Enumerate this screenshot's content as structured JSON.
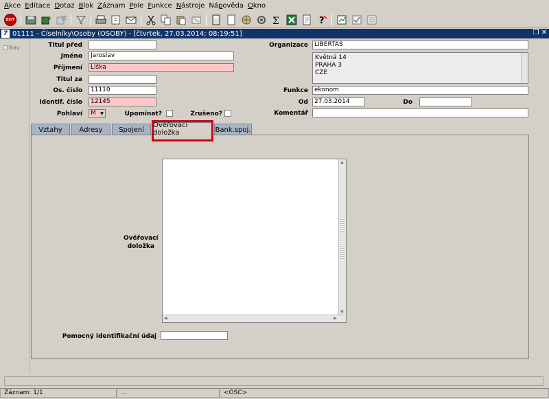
{
  "menu": [
    "Akce",
    "Editace",
    "Dotaz",
    "Blok",
    "Záznam",
    "Pole",
    "Funkce",
    "Nástroje",
    "Nápověda",
    "Okno"
  ],
  "menu_underline": [
    "A",
    "E",
    "D",
    "B",
    "Z",
    "P",
    "F",
    "N",
    "p",
    "O"
  ],
  "toolbar": {
    "exit_label": "EXIT",
    "icons": [
      "save-icon",
      "add-record-icon",
      "delete-record-icon",
      "filter-icon",
      "print-icon",
      "attach-icon",
      "mail-icon",
      "cut-icon",
      "copy-icon",
      "paste-icon",
      "clear-icon",
      "calculator-icon",
      "page-icon",
      "globe-icon",
      "tools-icon",
      "sum-icon",
      "excel-icon",
      "doc-icon",
      "help-icon",
      "report-icon",
      "check-icon",
      "list-icon"
    ]
  },
  "window": {
    "title": "01111 - Číselníky\\Osoby (OSOBY) - [čtvrtek, 27.03.2014; 08:19:51]",
    "logo": "7"
  },
  "nav": {
    "label": "Nav"
  },
  "form": {
    "titul_pred": {
      "label": "Titul před",
      "value": ""
    },
    "jmeno": {
      "label": "Jméno",
      "value": "Jaroslav"
    },
    "prijmeni": {
      "label": "Příjmení",
      "value": "Liška"
    },
    "titul_za": {
      "label": "Titul za",
      "value": ""
    },
    "os_cislo": {
      "label": "Os. číslo",
      "value": "11110"
    },
    "identif_cislo": {
      "label": "Identif. číslo",
      "value": "12145"
    },
    "pohlavi": {
      "label": "Pohlaví",
      "value": "M"
    },
    "upominat": {
      "label": "Upomínat?"
    },
    "zruseno": {
      "label": "Zrušeno?"
    },
    "organizace": {
      "label": "Organizace",
      "value": "LIBERTAS"
    },
    "adresa": [
      "Květná 14",
      "PRAHA 3",
      "CZE"
    ],
    "funkce": {
      "label": "Funkce",
      "value": "ekonom"
    },
    "od": {
      "label": "Od",
      "value": "27.03.2014"
    },
    "do": {
      "label": "Do",
      "value": ""
    },
    "komentar": {
      "label": "Komentář",
      "value": ""
    }
  },
  "tabs": [
    "Vztahy",
    "Adresy",
    "Spojení",
    "Ověřovací doložka",
    "Bank.spoj."
  ],
  "panel": {
    "doloska_label": "Ověřovací doložka",
    "pomocny_label": "Pomocný identifikační údaj",
    "pomocny_value": ""
  },
  "status": {
    "zaznam": "Záznam: 1/1",
    "ellipsis": "...",
    "osc": "<OSC>"
  },
  "colors": {
    "required": "#ffc8c8",
    "title_bar": "#10346a",
    "highlight": "#d00010",
    "tab": "#a8b4c4"
  }
}
